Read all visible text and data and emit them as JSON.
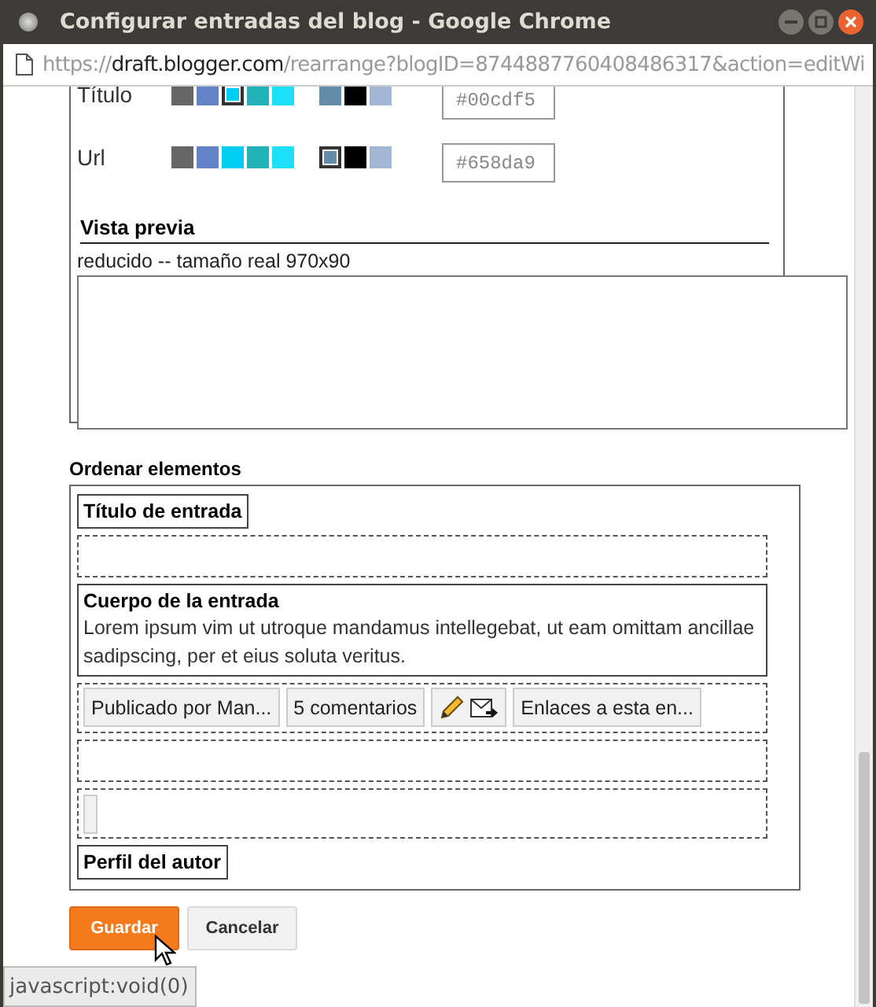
{
  "window": {
    "title": "Configurar entradas del blog - Google Chrome"
  },
  "address_bar": {
    "scheme": "https://",
    "host": "draft.blogger.com",
    "path": "/rearrange?blogID=8744887760408486317&action=editWi"
  },
  "color_rows": [
    {
      "label": "Título",
      "value": "#00cdf5",
      "swatches": [
        {
          "color": "#666666",
          "selected": false
        },
        {
          "color": "#6583c8",
          "selected": false
        },
        {
          "color": "#00cdf5",
          "selected": true
        },
        {
          "color": "#22b3b8",
          "selected": false
        },
        {
          "color": "#1ee0f8",
          "selected": false
        },
        {
          "color": "#658da9",
          "selected": false
        },
        {
          "color": "#000000",
          "selected": false
        },
        {
          "color": "#a2b6d6",
          "selected": false
        }
      ]
    },
    {
      "label": "Url",
      "value": "#658da9",
      "swatches": [
        {
          "color": "#666666",
          "selected": false
        },
        {
          "color": "#6583c8",
          "selected": false
        },
        {
          "color": "#00cdf5",
          "selected": false
        },
        {
          "color": "#22b3b8",
          "selected": false
        },
        {
          "color": "#1ee0f8",
          "selected": false
        },
        {
          "color": "#658da9",
          "selected": true
        },
        {
          "color": "#000000",
          "selected": false
        },
        {
          "color": "#a2b6d6",
          "selected": false
        }
      ]
    }
  ],
  "preview": {
    "heading": "Vista previa",
    "caption": "reducido -- tamaño real 970x90"
  },
  "arrange": {
    "heading": "Ordenar elementos",
    "items": [
      {
        "kind": "widget",
        "title": "Título de entrada"
      },
      {
        "kind": "zone"
      },
      {
        "kind": "widget",
        "title": "Cuerpo de la entrada",
        "body": "Lorem ipsum vim ut utroque mandamus intellegebat, ut eam omittam ancillae sadipscing, per et eius soluta veritus."
      },
      {
        "kind": "zone",
        "chips": [
          {
            "kind": "text",
            "label": "Publicado por Man..."
          },
          {
            "kind": "text",
            "label": "5 comentarios"
          },
          {
            "kind": "icons"
          },
          {
            "kind": "text",
            "label": "Enlaces a esta en..."
          }
        ]
      },
      {
        "kind": "zone"
      },
      {
        "kind": "zone",
        "chips": [
          {
            "kind": "blank"
          }
        ]
      },
      {
        "kind": "widget",
        "title": "Perfil del autor"
      }
    ]
  },
  "buttons": [
    {
      "kind": "primary",
      "label": "Guardar"
    },
    {
      "kind": "secondary",
      "label": "Cancelar"
    }
  ],
  "status_bar": {
    "text": "javascript:void(0)"
  }
}
